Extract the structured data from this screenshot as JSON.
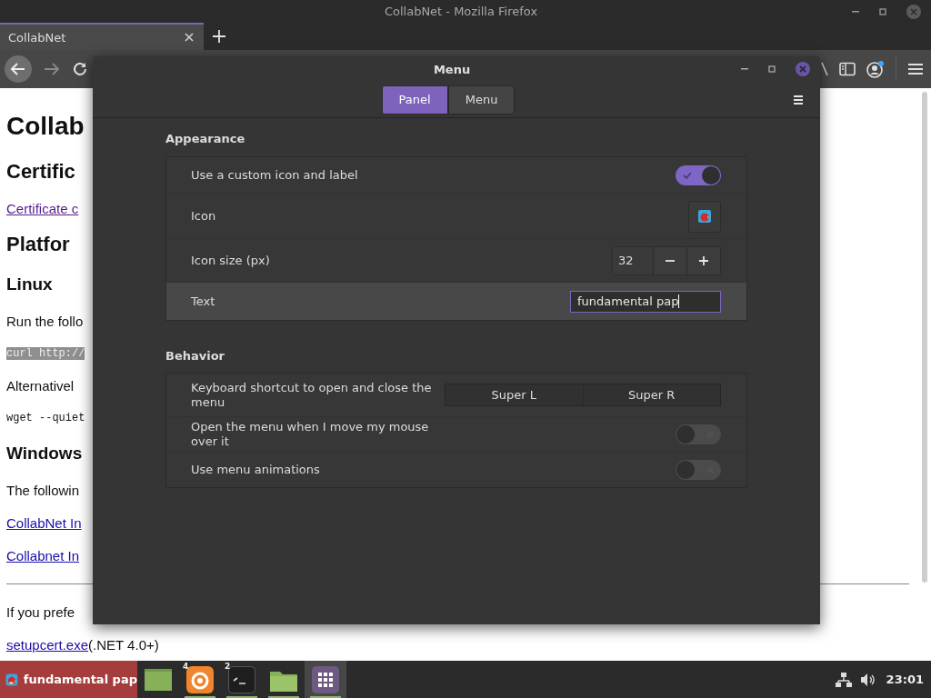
{
  "browser": {
    "title": "CollabNet - Mozilla Firefox",
    "tabs": [
      {
        "label": "CollabNet",
        "selected": true
      }
    ],
    "page": [
      {
        "kind": "h1",
        "text": "Collab"
      },
      {
        "kind": "h2",
        "text": "Certific"
      },
      {
        "kind": "link",
        "text": "Certificate c",
        "visited": true
      },
      {
        "kind": "h2",
        "text": "Platfor"
      },
      {
        "kind": "h3",
        "text": "Linux"
      },
      {
        "kind": "p",
        "text": "Run the follo"
      },
      {
        "kind": "code_selected",
        "text": "curl http://"
      },
      {
        "kind": "p",
        "text": "Alternativel"
      },
      {
        "kind": "code",
        "text": "wget --quiet"
      },
      {
        "kind": "h3",
        "text": "Windows"
      },
      {
        "kind": "p",
        "text": "The followin"
      },
      {
        "kind": "link",
        "text": "CollabNet In",
        "visited": false
      },
      {
        "kind": "link",
        "text": "Collabnet In",
        "visited": false
      },
      {
        "kind": "hr"
      },
      {
        "kind": "p",
        "text": "If you prefe"
      },
      {
        "kind": "link_line",
        "link": "setupcert.exe",
        "text": "(.NET 4.0+)"
      }
    ]
  },
  "dialog": {
    "title": "Menu",
    "tabs": [
      {
        "label": "Panel",
        "selected": true
      },
      {
        "label": "Menu",
        "selected": false
      }
    ],
    "sections": [
      {
        "title": "Appearance",
        "rows": [
          {
            "kind": "switch",
            "label": "Use a custom icon and label",
            "on": true,
            "selected": false
          },
          {
            "kind": "icon_button",
            "label": "Icon",
            "selected": false
          },
          {
            "kind": "spin",
            "label": "Icon size (px)",
            "value": "32",
            "selected": false
          },
          {
            "kind": "entry",
            "label": "Text",
            "value": "fundamental pap",
            "selected": true
          }
        ]
      },
      {
        "title": "Behavior",
        "rows": [
          {
            "kind": "shortcut",
            "label": "Keyboard shortcut to open and close the menu",
            "options": [
              "Super L",
              "Super R"
            ],
            "selected": false
          },
          {
            "kind": "switch",
            "label": "Open the menu when I move my mouse over it",
            "on": false,
            "selected": false
          },
          {
            "kind": "switch",
            "label": "Use menu animations",
            "on": false,
            "selected": false
          }
        ]
      }
    ]
  },
  "taskbar": {
    "menu_label": "fundamental pap",
    "apps": [
      {
        "kind": "window",
        "running": false,
        "selected": false
      },
      {
        "kind": "browser",
        "badge": "4",
        "running": true,
        "selected": false
      },
      {
        "kind": "terminal",
        "badge": "2",
        "running": true,
        "selected": false
      },
      {
        "kind": "folder",
        "running": true,
        "selected": false
      },
      {
        "kind": "apps",
        "running": true,
        "selected": true
      }
    ],
    "clock": "23:01"
  }
}
